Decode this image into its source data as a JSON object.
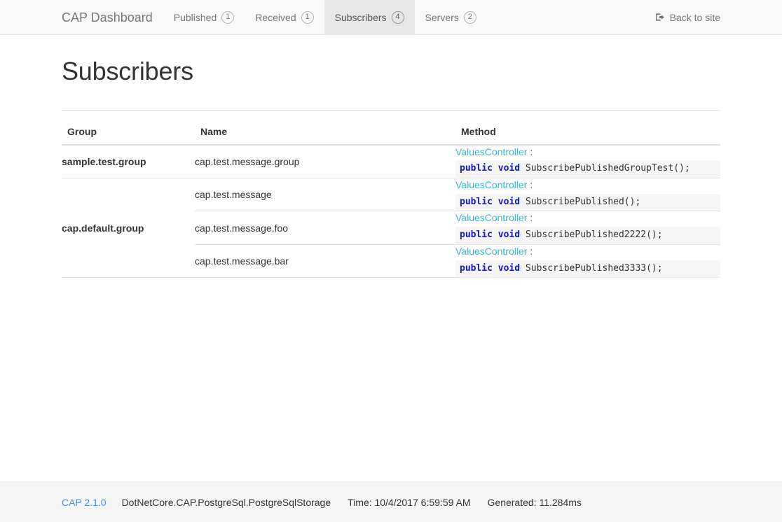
{
  "navbar": {
    "brand": "CAP Dashboard",
    "tabs": [
      {
        "label": "Published",
        "badge": "1",
        "active": false,
        "name": "tab-published"
      },
      {
        "label": "Received",
        "badge": "1",
        "active": false,
        "name": "tab-received"
      },
      {
        "label": "Subscribers",
        "badge": "4",
        "active": true,
        "name": "tab-subscribers"
      },
      {
        "label": "Servers",
        "badge": "2",
        "active": false,
        "name": "tab-servers"
      }
    ],
    "back_link": {
      "label": "Back to site",
      "icon": "sign-out-icon"
    }
  },
  "page": {
    "title": "Subscribers"
  },
  "table": {
    "headers": {
      "group": "Group",
      "name": "Name",
      "method": "Method"
    },
    "groups": [
      {
        "group": "sample.test.group",
        "rows": [
          {
            "name": "cap.test.message.group",
            "controller": "ValuesController",
            "separator": ":",
            "modifiers": "public void",
            "signature": "SubscribePublishedGroupTest();"
          }
        ]
      },
      {
        "group": "cap.default.group",
        "rows": [
          {
            "name": "cap.test.message",
            "controller": "ValuesController",
            "separator": ":",
            "modifiers": "public void",
            "signature": "SubscribePublished();"
          },
          {
            "name": "cap.test.message.foo",
            "controller": "ValuesController",
            "separator": ":",
            "modifiers": "public void",
            "signature": "SubscribePublished2222();"
          },
          {
            "name": "cap.test.message.bar",
            "controller": "ValuesController",
            "separator": ":",
            "modifiers": "public void",
            "signature": "SubscribePublished3333();"
          }
        ]
      }
    ]
  },
  "footer": {
    "version": "CAP 2.1.0",
    "storage": "DotNetCore.CAP.PostgreSql.PostgreSqlStorage",
    "time": "Time: 10/4/2017 6:59:59 AM",
    "generated": "Generated: 11.284ms"
  },
  "colors": {
    "accent_cyan": "#2bbbd8",
    "keyword_blue": "#1414d2",
    "link_blue": "#4a90d9",
    "navbar_bg": "#f8f8f8",
    "active_tab_bg": "#e7e7e7",
    "code_bg": "#f5f5f5"
  }
}
